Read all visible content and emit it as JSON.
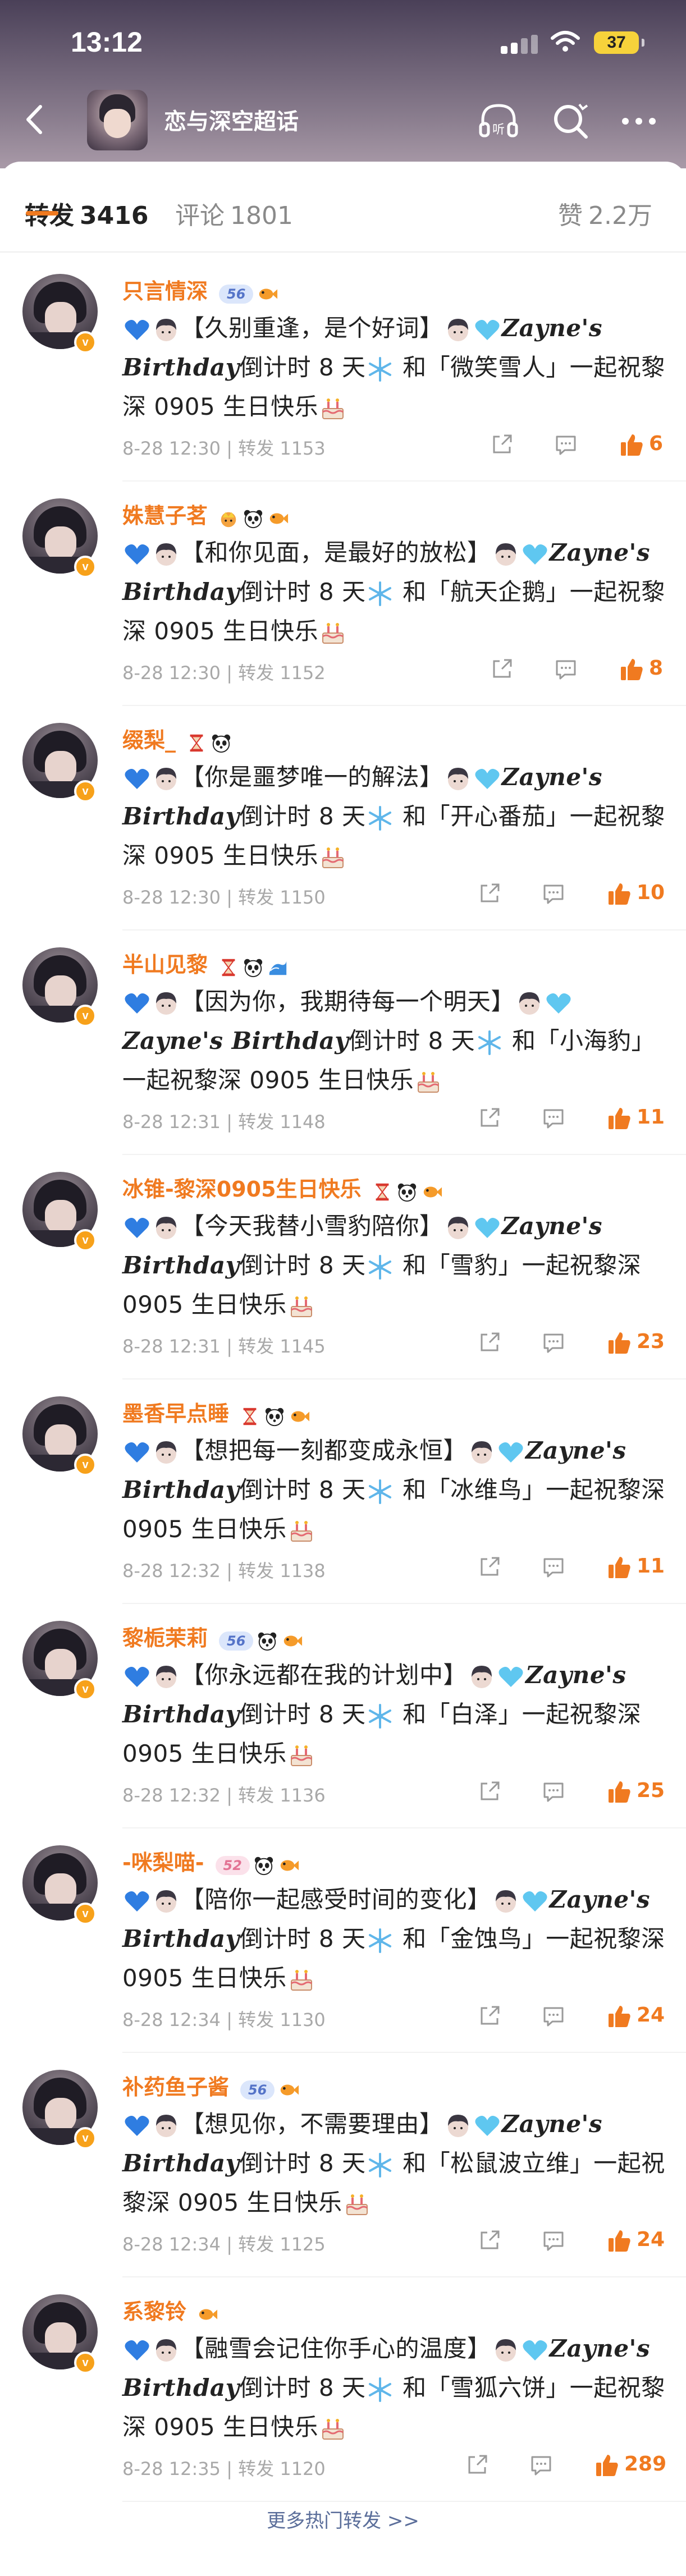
{
  "status_bar": {
    "time": "13:12",
    "battery": "37"
  },
  "navbar": {
    "title": "恋与深空超话"
  },
  "tabs": [
    {
      "label": "转发",
      "count": "3416",
      "active": true
    },
    {
      "label": "评论",
      "count": "1801",
      "active": false
    },
    {
      "label": "赞",
      "count": "2.2万",
      "active": false
    }
  ],
  "posts": [
    {
      "username": "只言情深",
      "level": "56",
      "level_color": "blue",
      "badge_icons": [
        "fish-icon"
      ],
      "segments": [
        {
          "t": "【久别重逢，是个好词】"
        },
        {
          "t": "Zayne's Birthday",
          "i": true
        },
        {
          "t": "倒计时 8 天"
        },
        {
          "t": " 和「微笑雪人」一起祝黎深 0905 生日快乐"
        }
      ],
      "time": "8-28 12:30",
      "repost_label": "转发",
      "repost_count": "1153",
      "likes": "6"
    },
    {
      "username": "姝慧子茗",
      "level": "",
      "level_color": "",
      "badge_icons": [
        "crown-icon",
        "panda-icon",
        "fish-icon"
      ],
      "segments": [
        {
          "t": "【和你见面，是最好的放松】"
        },
        {
          "t": "Zayne's Birthday",
          "i": true
        },
        {
          "t": "倒计时 8 天"
        },
        {
          "t": " 和「航天企鹅」一起祝黎深 0905 生日快乐"
        }
      ],
      "time": "8-28 12:30",
      "repost_label": "转发",
      "repost_count": "1152",
      "likes": "8"
    },
    {
      "username": "缀梨_",
      "level": "",
      "level_color": "",
      "badge_icons": [
        "hourglass-icon",
        "panda-icon"
      ],
      "segments": [
        {
          "t": "【你是噩梦唯一的解法】"
        },
        {
          "t": "Zayne's Birthday",
          "i": true
        },
        {
          "t": "倒计时 8 天"
        },
        {
          "t": " 和「开心番茄」一起祝黎深 0905 生日快乐"
        }
      ],
      "time": "8-28 12:30",
      "repost_label": "转发",
      "repost_count": "1150",
      "likes": "10"
    },
    {
      "username": "半山见黎",
      "level": "",
      "level_color": "",
      "badge_icons": [
        "hourglass-icon",
        "panda-icon",
        "wave-icon"
      ],
      "segments": [
        {
          "t": "【因为你，我期待每一个明天】"
        },
        {
          "t": "Zayne's Birthday",
          "i": true
        },
        {
          "t": "倒计时 8 天"
        },
        {
          "t": " 和「小海豹」一起祝黎深 0905 生日快乐"
        }
      ],
      "time": "8-28 12:31",
      "repost_label": "转发",
      "repost_count": "1148",
      "likes": "11"
    },
    {
      "username": "冰锥-黎深0905生日快乐",
      "level": "",
      "level_color": "",
      "badge_icons": [
        "hourglass-icon",
        "panda-icon",
        "fish-icon"
      ],
      "segments": [
        {
          "t": "【今天我替小雪豹陪你】"
        },
        {
          "t": "Zayne's Birthday",
          "i": true
        },
        {
          "t": "倒计时 8 天"
        },
        {
          "t": " 和「雪豹」一起祝黎深 0905 生日快乐"
        }
      ],
      "time": "8-28 12:31",
      "repost_label": "转发",
      "repost_count": "1145",
      "likes": "23"
    },
    {
      "username": "墨香早点睡",
      "level": "",
      "level_color": "",
      "badge_icons": [
        "hourglass-icon",
        "panda-icon",
        "fish-icon"
      ],
      "segments": [
        {
          "t": "【想把每一刻都变成永恒】"
        },
        {
          "t": "Zayne's Birthday",
          "i": true
        },
        {
          "t": "倒计时 8 天"
        },
        {
          "t": " 和「冰维鸟」一起祝黎深 0905 生日快乐"
        }
      ],
      "time": "8-28 12:32",
      "repost_label": "转发",
      "repost_count": "1138",
      "likes": "11"
    },
    {
      "username": "黎栀茉莉",
      "level": "56",
      "level_color": "blue",
      "badge_icons": [
        "panda-icon",
        "fish-icon"
      ],
      "segments": [
        {
          "t": "【你永远都在我的计划中】"
        },
        {
          "t": "Zayne's Birthday",
          "i": true
        },
        {
          "t": "倒计时 8 天"
        },
        {
          "t": " 和「白泽」一起祝黎深 0905 生日快乐"
        }
      ],
      "time": "8-28 12:32",
      "repost_label": "转发",
      "repost_count": "1136",
      "likes": "25"
    },
    {
      "username": "-咪梨喵-",
      "level": "52",
      "level_color": "pink",
      "badge_icons": [
        "panda-icon",
        "fish-icon"
      ],
      "segments": [
        {
          "t": "【陪你一起感受时间的变化】"
        },
        {
          "t": "Zayne's Birthday",
          "i": true
        },
        {
          "t": "倒计时 8 天"
        },
        {
          "t": " 和「金蚀鸟」一起祝黎深 0905 生日快乐"
        }
      ],
      "time": "8-28 12:34",
      "repost_label": "转发",
      "repost_count": "1130",
      "likes": "24"
    },
    {
      "username": "补药鱼子酱",
      "level": "56",
      "level_color": "blue",
      "badge_icons": [
        "fish-icon"
      ],
      "segments": [
        {
          "t": "【想见你，不需要理由】"
        },
        {
          "t": "Zayne's Birthday",
          "i": true
        },
        {
          "t": "倒计时 8 天"
        },
        {
          "t": " 和「松鼠波立维」一起祝黎深 0905 生日快乐"
        }
      ],
      "time": "8-28 12:34",
      "repost_label": "转发",
      "repost_count": "1125",
      "likes": "24"
    },
    {
      "username": "系黎铃",
      "level": "",
      "level_color": "",
      "badge_icons": [
        "fish-icon"
      ],
      "segments": [
        {
          "t": "【融雪会记住你手心的温度】"
        },
        {
          "t": "Zayne's Birthday",
          "i": true
        },
        {
          "t": "倒计时 8 天"
        },
        {
          "t": " 和「雪狐六饼」一起祝黎深 0905 生日快乐"
        }
      ],
      "time": "8-28 12:35",
      "repost_label": "转发",
      "repost_count": "1120",
      "likes": "289"
    }
  ],
  "footer": {
    "more_label": "更多热门转发 >>"
  }
}
